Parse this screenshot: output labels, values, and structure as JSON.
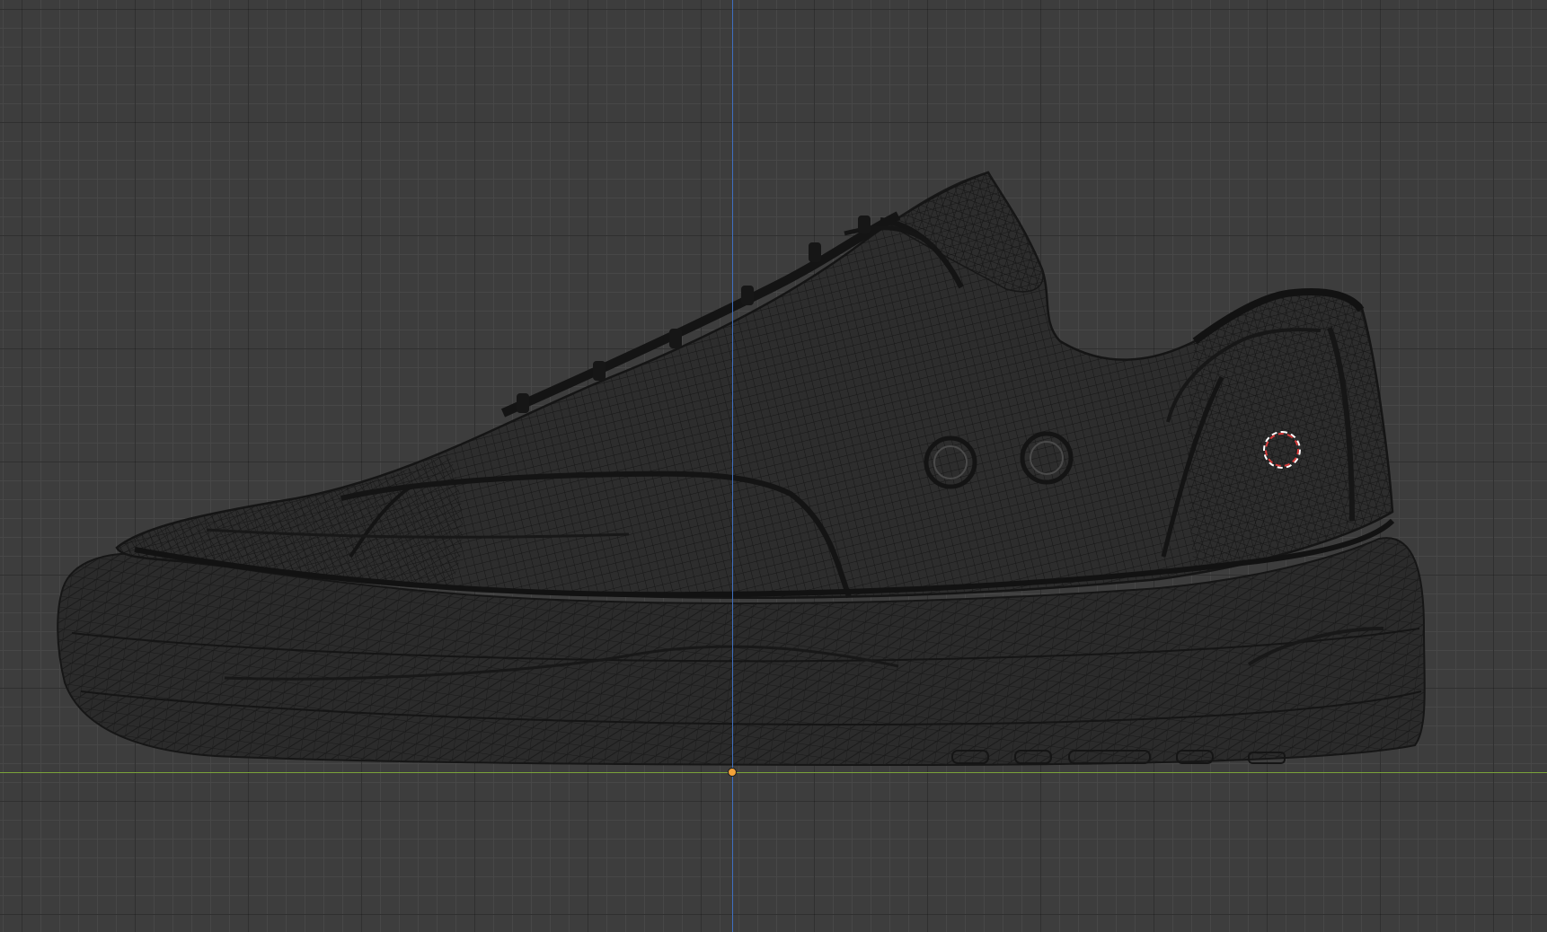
{
  "viewport": {
    "mode": "wireframe",
    "background_color": "#3d3d3d",
    "grid": true
  },
  "axes": {
    "x_axis_color": "#7aa33a",
    "z_axis_color": "#3f6fbf"
  },
  "scene_object": {
    "name_icon": "sneaker-mesh",
    "wire_color": "#161616",
    "eyelet_count": 2
  },
  "origin_marker": {
    "icon": "origin-point",
    "color": "#f2a23a"
  },
  "cursor_3d": {
    "icon": "3d-cursor",
    "colors": [
      "#ffffff",
      "#d63a3a"
    ]
  }
}
